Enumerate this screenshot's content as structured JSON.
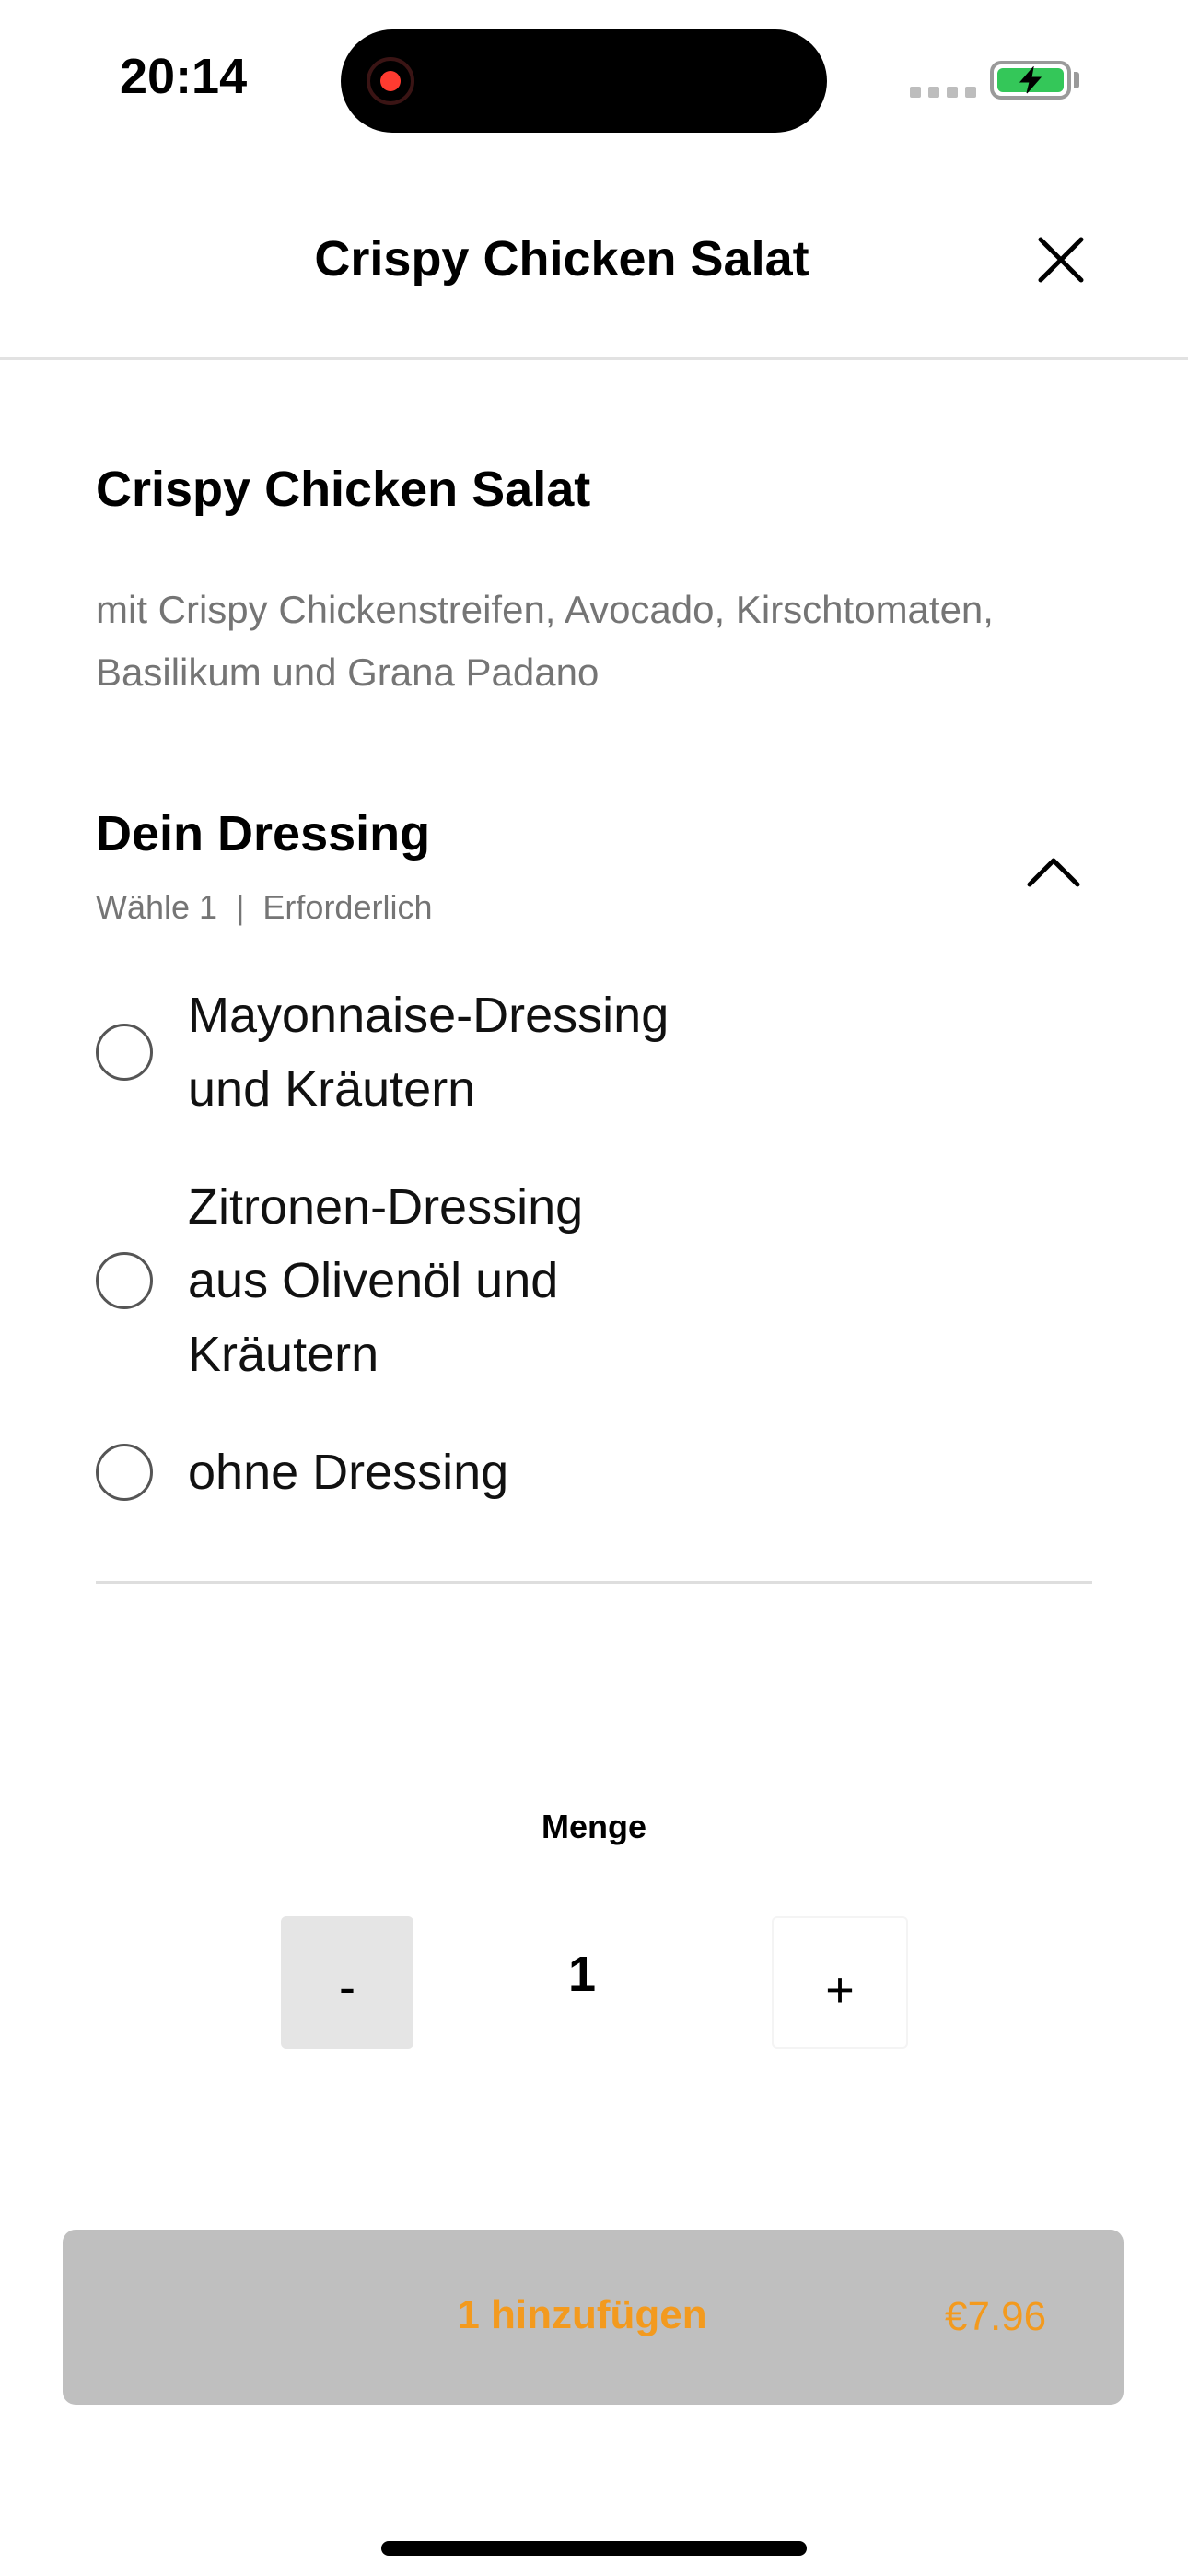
{
  "status_bar": {
    "time": "20:14"
  },
  "header": {
    "title": "Crispy Chicken Salat",
    "close_icon": "close-icon"
  },
  "product": {
    "name": "Crispy Chicken Salat",
    "description": "mit Crispy Chickenstreifen, Avocado, Kirschtomaten, Basilikum und Grana Padano"
  },
  "dressing_section": {
    "title": "Dein Dressing",
    "subtitle": "Wähle 1  |  Erforderlich",
    "collapse_icon": "chevron-up-icon",
    "options": [
      {
        "label": "Mayonnaise-Dressing und Kräutern",
        "selected": false
      },
      {
        "label": "Zitronen-Dressing aus Olivenöl und Kräutern",
        "selected": false
      },
      {
        "label": "ohne Dressing",
        "selected": false
      }
    ]
  },
  "quantity": {
    "label": "Menge",
    "minus_label": "-",
    "value": "1",
    "plus_label": "+"
  },
  "add_button": {
    "label": "1 hinzufügen",
    "price": "€7.96"
  },
  "colors": {
    "accent": "#f39a1e",
    "button_disabled_bg": "#bfbfbf",
    "battery": "#34c759",
    "recording": "#ff3b30"
  }
}
